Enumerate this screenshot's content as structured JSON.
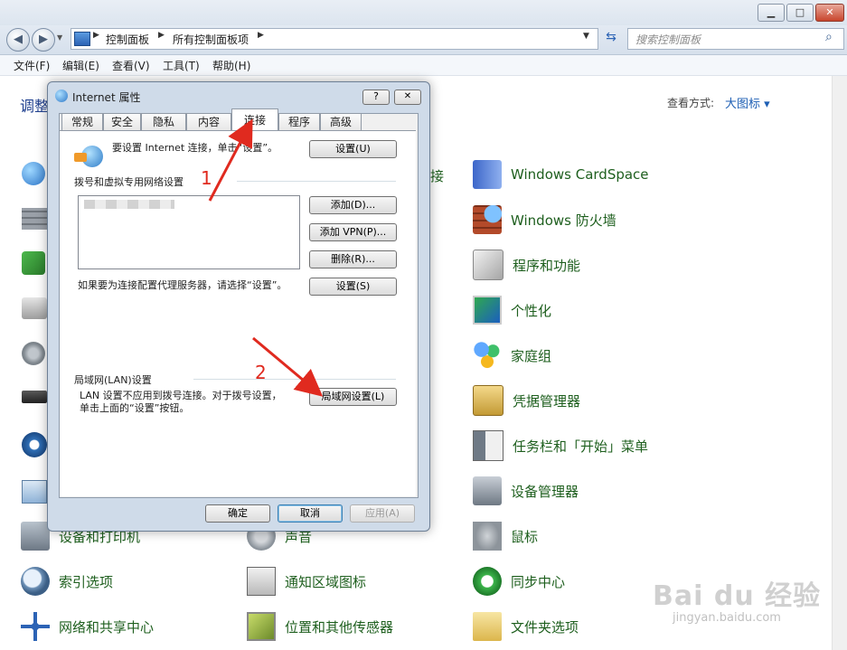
{
  "window": {
    "caption_minimize": "▁",
    "caption_maximize": "□",
    "caption_close": "✕"
  },
  "address": {
    "crumb1": "控制面板",
    "crumb2": "所有控制面板项",
    "search_placeholder": "搜索控制面板"
  },
  "menu": {
    "file": "文件(F)",
    "edit": "编辑(E)",
    "view": "查看(V)",
    "tools": "工具(T)",
    "help": "帮助(H)"
  },
  "content_header": {
    "title_partial": "调整",
    "view_label": "查看方式:",
    "view_value": "大图标 ▾"
  },
  "cp_items": {
    "mid_partial_top": "接",
    "col2": [
      {
        "label": "Windows CardSpace"
      },
      {
        "label": "Windows 防火墙"
      },
      {
        "label": "程序和功能"
      },
      {
        "label": "个性化"
      },
      {
        "label": "家庭组"
      },
      {
        "label": "凭据管理器"
      },
      {
        "label": "任务栏和「开始」菜单"
      },
      {
        "label": "设备管理器"
      },
      {
        "label": "鼠标"
      },
      {
        "label": "同步中心"
      },
      {
        "label": "文件夹选项"
      }
    ],
    "row_devices_printers": "设备和打印机",
    "row_sound": "声音",
    "row_index": "索引选项",
    "row_notify": "通知区域图标",
    "row_network": "网络和共享中心",
    "row_location": "位置和其他传感器"
  },
  "dialog": {
    "title": "Internet 属性",
    "help_btn": "?",
    "close_btn": "✕",
    "tabs": [
      "常规",
      "安全",
      "隐私",
      "内容",
      "连接",
      "程序",
      "高级"
    ],
    "setup_text": "要设置 Internet 连接，单击“设置”。",
    "setup_btn": "设置(U)",
    "dialup_group": "拨号和虚拟专用网络设置",
    "add_btn": "添加(D)...",
    "add_vpn_btn": "添加 VPN(P)...",
    "remove_btn": "删除(R)...",
    "proxy_text": "如果要为连接配置代理服务器，请选择“设置”。",
    "settings_btn": "设置(S)",
    "lan_group": "局域网(LAN)设置",
    "lan_text": "LAN 设置不应用到拨号连接。对于拨号设置，单击上面的“设置”按钮。",
    "lan_btn": "局域网设置(L)",
    "ok_btn": "确定",
    "cancel_btn": "取消",
    "apply_btn": "应用(A)"
  },
  "annotations": {
    "step1": "1",
    "step2": "2"
  },
  "watermark": {
    "text": "Bai du 经验",
    "url": "jingyan.baidu.com"
  }
}
